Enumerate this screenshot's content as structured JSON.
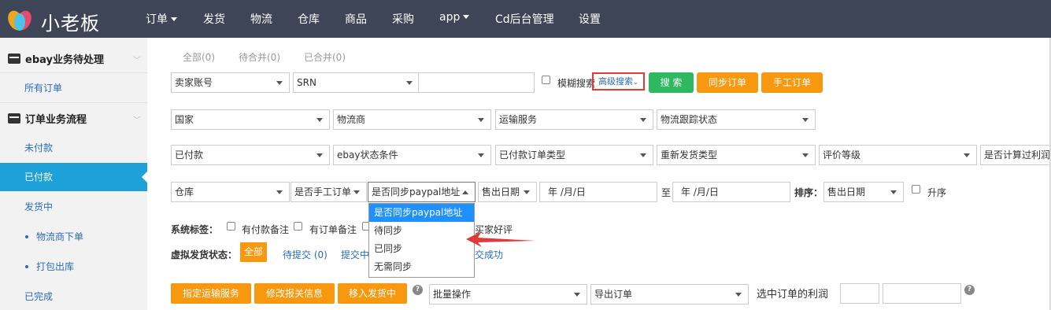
{
  "brand": {
    "name": "小老板"
  },
  "nav": [
    {
      "label": "订单",
      "caret": true
    },
    {
      "label": "发货",
      "caret": false
    },
    {
      "label": "物流",
      "caret": false
    },
    {
      "label": "仓库",
      "caret": false
    },
    {
      "label": "商品",
      "caret": false
    },
    {
      "label": "采购",
      "caret": false
    },
    {
      "label": "app",
      "caret": true
    },
    {
      "label": "Cd后台管理",
      "caret": false
    },
    {
      "label": "设置",
      "caret": false
    }
  ],
  "sidebar": {
    "section1": "ebay业务待处理",
    "all_orders": "所有订单",
    "section2": "订单业务流程",
    "unpaid": "未付款",
    "paid": "已付款",
    "shipping": "发货中",
    "logistics_order": "物流商下单",
    "pack_out": "打包出库",
    "completed": "已完成"
  },
  "tabs": {
    "all": "全部(0)",
    "pending_merge": "待合并(0)",
    "merged": "已合并(0)"
  },
  "row1": {
    "seller_account": "卖家账号",
    "srn": "SRN",
    "fuzzy_search": "模糊搜索",
    "advanced_search": "高级搜索",
    "search_btn": "搜 索",
    "sync_btn": "同步订单",
    "manual_btn": "手工订单"
  },
  "row2": {
    "country": "国家",
    "carrier": "物流商",
    "shipping_service": "运输服务",
    "tracking_status": "物流跟踪状态"
  },
  "row3": {
    "paid": "已付款",
    "ebay_status": "ebay状态条件",
    "paid_type": "已付款订单类型",
    "reship_type": "重新发货类型",
    "rating_level": "评价等级",
    "profit_calc": "是否计算过利润"
  },
  "row4": {
    "warehouse": "仓库",
    "manual_order": "是否手工订单",
    "paypal_sync": "是否同步paypal地址",
    "sale_date": "售出日期",
    "date_placeholder": "年 /月/日",
    "to": "至",
    "sort_label": "排序：",
    "sort_value": "售出日期",
    "ascending": "升序"
  },
  "dropdown": {
    "options": [
      "是否同步paypal地址",
      "待同步",
      "已同步",
      "无需同步"
    ],
    "highlighted_index": 0
  },
  "tags": {
    "label": "系统标签：",
    "paid_note": "有付款备注",
    "order_note": "有订单备注",
    "buyer_praise": "买家好评"
  },
  "virtual": {
    "label": "虚拟发货状态：",
    "all": "全部",
    "pending": "待提交 (0)",
    "submitting": "提交中",
    "success": "交成功"
  },
  "actions": {
    "assign_shipping": "指定运输服务",
    "modify_customs": "修改报关信息",
    "move_shipping": "移入发货中",
    "batch": "批量操作",
    "export": "导出订单",
    "profit_label": "选中订单的利润",
    "help": "?"
  },
  "colors": {
    "topbar": "#3d4556",
    "orange": "#f7980e",
    "green": "#2eb85f",
    "active": "#1ea0d9",
    "link": "#2a6db5",
    "highlight": "#1e90ff",
    "red": "#e03a3a"
  }
}
